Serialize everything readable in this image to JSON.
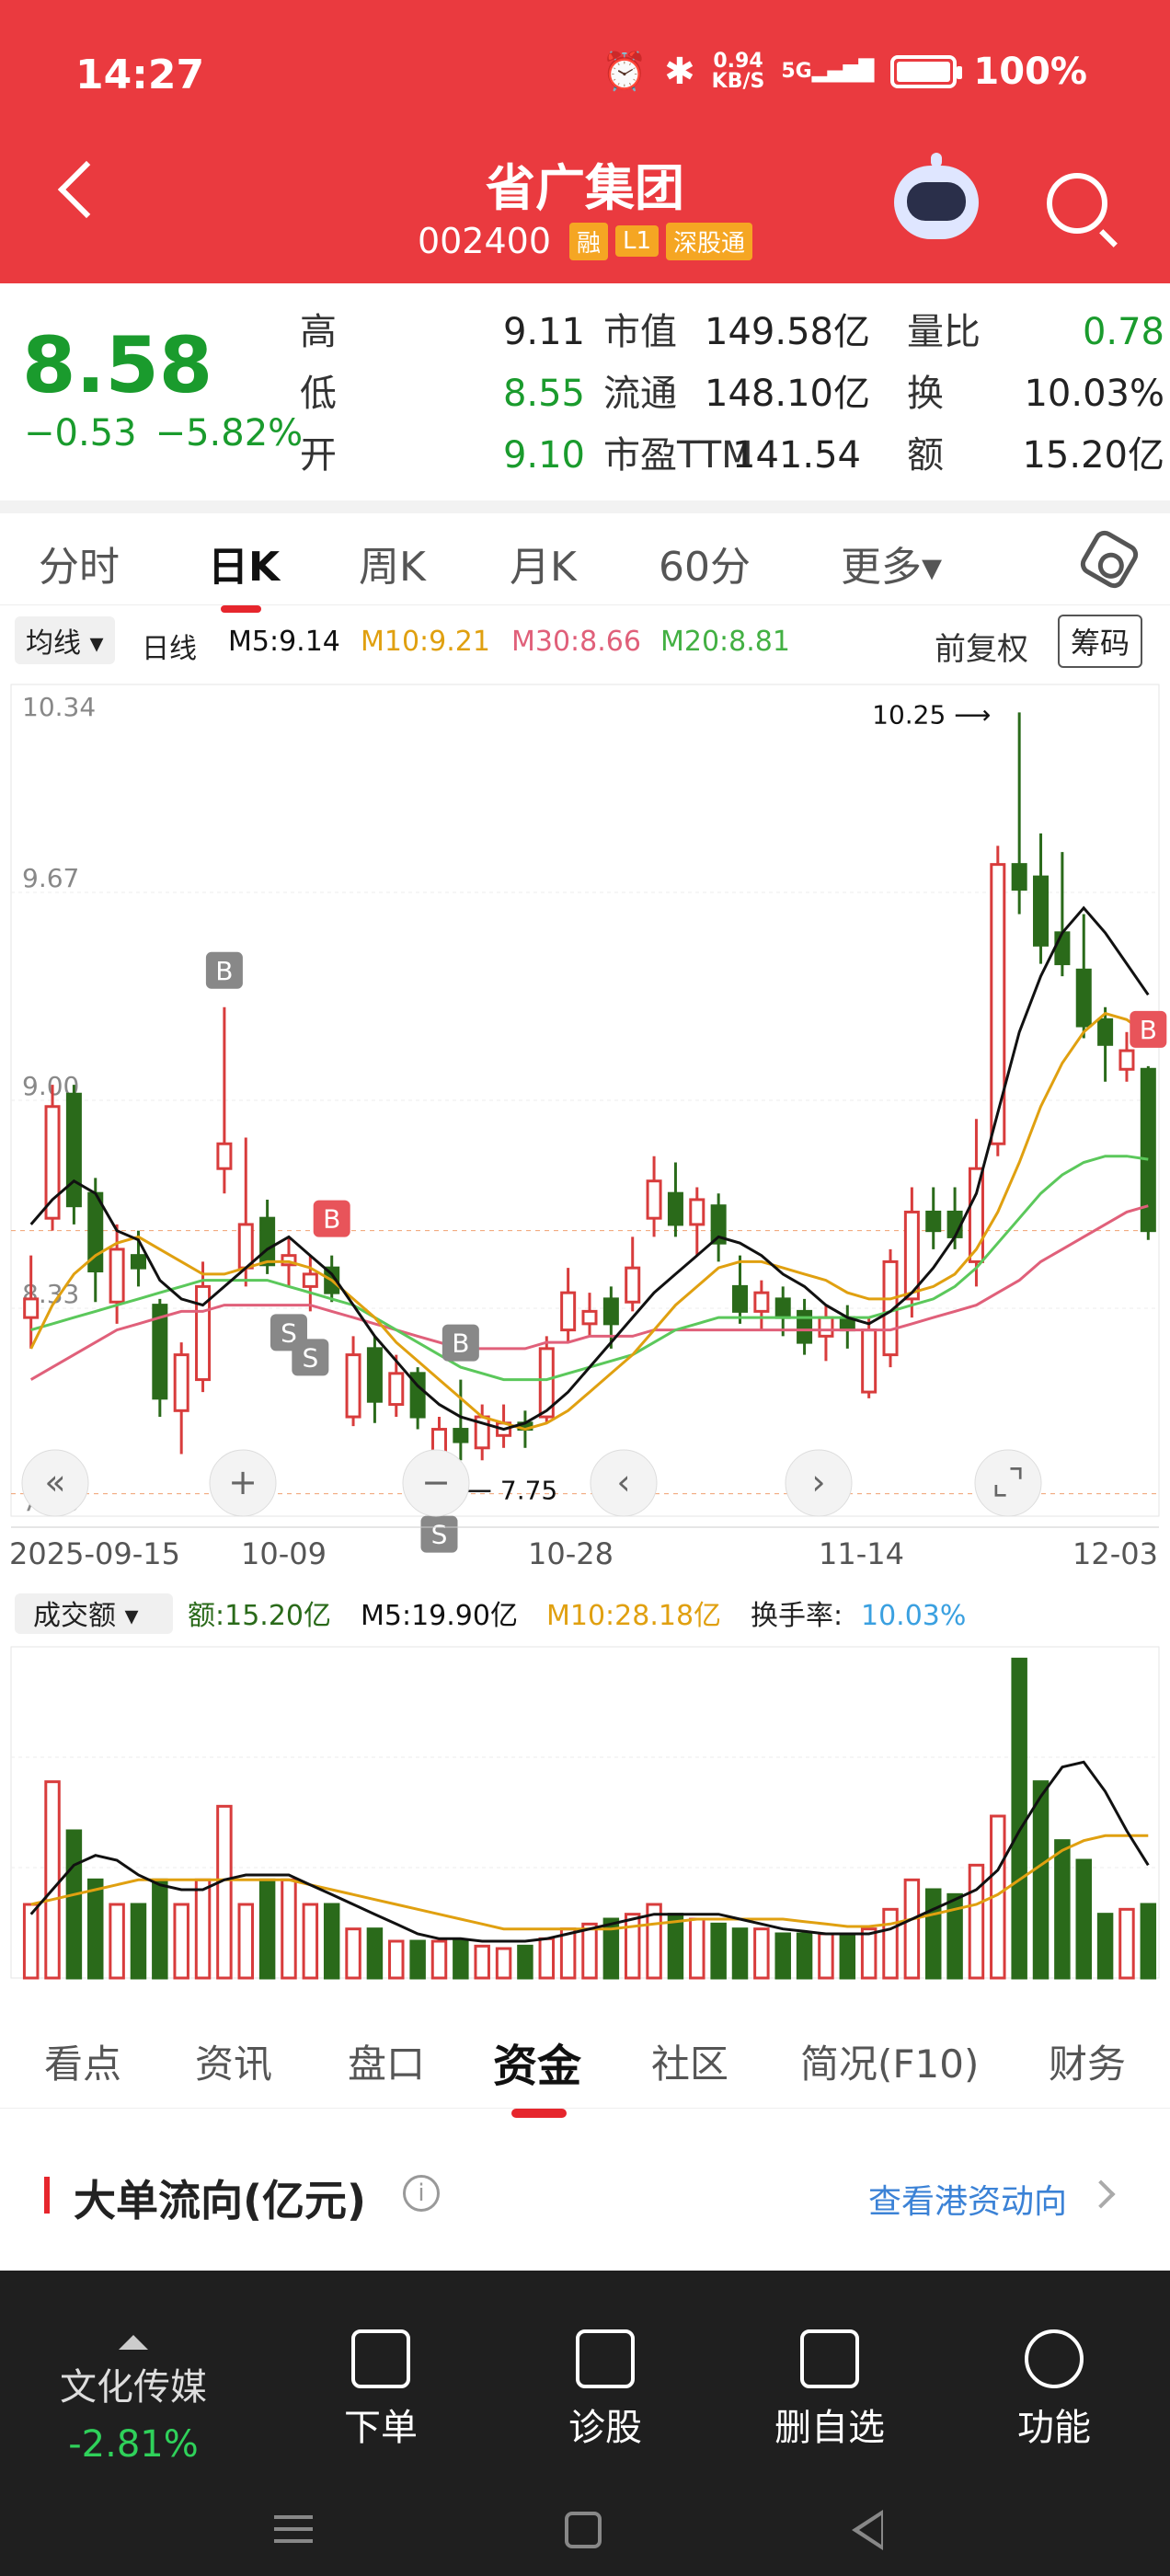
{
  "status": {
    "time": "14:27",
    "netspeed_value": "0.94",
    "netspeed_unit": "KB/S",
    "signal": "5G",
    "battery": "100%"
  },
  "header": {
    "title": "省广集团",
    "code": "002400",
    "tags": [
      "融",
      "L1",
      "深股通"
    ]
  },
  "quote": {
    "price": "8.58",
    "change": "−0.53",
    "change_pct": "−5.82%",
    "rows": [
      {
        "l1": "高",
        "v1": "9.11",
        "l2": "市值",
        "v2": "149.58亿",
        "l3": "量比",
        "v3": "0.78"
      },
      {
        "l1": "低",
        "v1": "8.55",
        "l2": "流通",
        "v2": "148.10亿",
        "l3": "换",
        "v3": "10.03%"
      },
      {
        "l1": "开",
        "v1": "9.10",
        "l2": "市盈TTM",
        "v2": "141.54",
        "l3": "额",
        "v3": "15.20亿"
      }
    ]
  },
  "period_tabs": [
    "分时",
    "日K",
    "周K",
    "月K",
    "60分",
    "更多▾"
  ],
  "ma_legend": {
    "selector": "均线 ▾",
    "period": "日线",
    "m5": "M5:9.14",
    "m10": "M10:9.21",
    "m30": "M30:8.66",
    "m20": "M20:8.81",
    "fq": "前复权",
    "chip": "筹码"
  },
  "chart_data": {
    "type": "candlestick",
    "y_ticks": [
      "10.34",
      "9.67",
      "9.00",
      "8.33",
      "7.66"
    ],
    "x_ticks": [
      "2025-09-15",
      "10-09",
      "10-28",
      "11-14",
      "12-03"
    ],
    "high_label": "10.25",
    "low_label": "7.75",
    "ylim": [
      7.66,
      10.34
    ],
    "candles": [
      {
        "o": 8.3,
        "c": 8.36,
        "h": 8.5,
        "l": 8.2
      },
      {
        "o": 8.62,
        "c": 8.98,
        "h": 9.05,
        "l": 8.58
      },
      {
        "o": 9.02,
        "c": 8.66,
        "h": 9.05,
        "l": 8.6
      },
      {
        "o": 8.7,
        "c": 8.45,
        "h": 8.75,
        "l": 8.35
      },
      {
        "o": 8.35,
        "c": 8.52,
        "h": 8.6,
        "l": 8.28
      },
      {
        "o": 8.5,
        "c": 8.46,
        "h": 8.58,
        "l": 8.4
      },
      {
        "o": 8.34,
        "c": 8.04,
        "h": 8.36,
        "l": 7.98
      },
      {
        "o": 8.0,
        "c": 8.18,
        "h": 8.22,
        "l": 7.86
      },
      {
        "o": 8.1,
        "c": 8.4,
        "h": 8.48,
        "l": 8.06
      },
      {
        "o": 8.78,
        "c": 8.86,
        "h": 9.3,
        "l": 8.7
      },
      {
        "o": 8.46,
        "c": 8.6,
        "h": 8.88,
        "l": 8.4
      },
      {
        "o": 8.62,
        "c": 8.47,
        "h": 8.68,
        "l": 8.44
      },
      {
        "o": 8.47,
        "c": 8.5,
        "h": 8.56,
        "l": 8.4
      },
      {
        "o": 8.4,
        "c": 8.44,
        "h": 8.5,
        "l": 8.32
      },
      {
        "o": 8.46,
        "c": 8.38,
        "h": 8.5,
        "l": 8.35
      },
      {
        "o": 7.98,
        "c": 8.18,
        "h": 8.24,
        "l": 7.95
      },
      {
        "o": 8.2,
        "c": 8.03,
        "h": 8.24,
        "l": 7.96
      },
      {
        "o": 8.02,
        "c": 8.12,
        "h": 8.18,
        "l": 7.98
      },
      {
        "o": 8.12,
        "c": 7.98,
        "h": 8.14,
        "l": 7.94
      },
      {
        "o": 7.86,
        "c": 7.94,
        "h": 7.98,
        "l": 7.75
      },
      {
        "o": 7.94,
        "c": 7.9,
        "h": 8.1,
        "l": 7.84
      },
      {
        "o": 7.88,
        "c": 7.98,
        "h": 8.02,
        "l": 7.84
      },
      {
        "o": 7.92,
        "c": 7.96,
        "h": 8.02,
        "l": 7.88
      },
      {
        "o": 7.96,
        "c": 7.94,
        "h": 8.0,
        "l": 7.88
      },
      {
        "o": 7.98,
        "c": 8.2,
        "h": 8.24,
        "l": 7.96
      },
      {
        "o": 8.26,
        "c": 8.38,
        "h": 8.46,
        "l": 8.22
      },
      {
        "o": 8.28,
        "c": 8.32,
        "h": 8.38,
        "l": 8.24
      },
      {
        "o": 8.36,
        "c": 8.28,
        "h": 8.4,
        "l": 8.2
      },
      {
        "o": 8.35,
        "c": 8.46,
        "h": 8.56,
        "l": 8.32
      },
      {
        "o": 8.62,
        "c": 8.74,
        "h": 8.82,
        "l": 8.56
      },
      {
        "o": 8.7,
        "c": 8.6,
        "h": 8.8,
        "l": 8.56
      },
      {
        "o": 8.6,
        "c": 8.68,
        "h": 8.72,
        "l": 8.5
      },
      {
        "o": 8.66,
        "c": 8.54,
        "h": 8.7,
        "l": 8.48
      },
      {
        "o": 8.4,
        "c": 8.32,
        "h": 8.5,
        "l": 8.28
      },
      {
        "o": 8.32,
        "c": 8.38,
        "h": 8.42,
        "l": 8.26
      },
      {
        "o": 8.36,
        "c": 8.3,
        "h": 8.4,
        "l": 8.24
      },
      {
        "o": 8.32,
        "c": 8.22,
        "h": 8.36,
        "l": 8.18
      },
      {
        "o": 8.24,
        "c": 8.3,
        "h": 8.34,
        "l": 8.16
      },
      {
        "o": 8.3,
        "c": 8.26,
        "h": 8.34,
        "l": 8.2
      },
      {
        "o": 8.06,
        "c": 8.26,
        "h": 8.3,
        "l": 8.04
      },
      {
        "o": 8.18,
        "c": 8.48,
        "h": 8.52,
        "l": 8.14
      },
      {
        "o": 8.36,
        "c": 8.64,
        "h": 8.72,
        "l": 8.3
      },
      {
        "o": 8.64,
        "c": 8.58,
        "h": 8.72,
        "l": 8.52
      },
      {
        "o": 8.64,
        "c": 8.56,
        "h": 8.72,
        "l": 8.52
      },
      {
        "o": 8.48,
        "c": 8.78,
        "h": 8.94,
        "l": 8.4
      },
      {
        "o": 8.86,
        "c": 9.76,
        "h": 9.82,
        "l": 8.82
      },
      {
        "o": 9.76,
        "c": 9.68,
        "h": 10.25,
        "l": 9.6
      },
      {
        "o": 9.72,
        "c": 9.5,
        "h": 9.86,
        "l": 9.44
      },
      {
        "o": 9.54,
        "c": 9.44,
        "h": 9.8,
        "l": 9.4
      },
      {
        "o": 9.42,
        "c": 9.24,
        "h": 9.6,
        "l": 9.2
      },
      {
        "o": 9.26,
        "c": 9.18,
        "h": 9.3,
        "l": 9.06
      },
      {
        "o": 9.1,
        "c": 9.16,
        "h": 9.22,
        "l": 9.06
      },
      {
        "o": 9.1,
        "c": 8.58,
        "h": 9.11,
        "l": 8.55
      }
    ],
    "ma": {
      "M5": [
        8.6,
        8.68,
        8.74,
        8.7,
        8.58,
        8.55,
        8.42,
        8.36,
        8.34,
        8.4,
        8.46,
        8.52,
        8.56,
        8.5,
        8.44,
        8.34,
        8.24,
        8.16,
        8.08,
        8.02,
        7.98,
        7.96,
        7.94,
        7.96,
        8.0,
        8.06,
        8.14,
        8.22,
        8.3,
        8.38,
        8.44,
        8.5,
        8.56,
        8.54,
        8.5,
        8.44,
        8.4,
        8.34,
        8.3,
        8.28,
        8.32,
        8.38,
        8.46,
        8.56,
        8.7,
        8.96,
        9.22,
        9.4,
        9.54,
        9.62,
        9.54,
        9.44,
        9.34
      ],
      "M10": [
        8.2,
        8.34,
        8.44,
        8.5,
        8.54,
        8.56,
        8.52,
        8.48,
        8.44,
        8.44,
        8.46,
        8.48,
        8.48,
        8.46,
        8.42,
        8.36,
        8.3,
        8.22,
        8.16,
        8.1,
        8.04,
        7.98,
        7.96,
        7.94,
        7.96,
        8.0,
        8.06,
        8.12,
        8.18,
        8.26,
        8.34,
        8.4,
        8.46,
        8.48,
        8.48,
        8.46,
        8.44,
        8.42,
        8.38,
        8.36,
        8.36,
        8.38,
        8.4,
        8.44,
        8.52,
        8.64,
        8.8,
        8.98,
        9.12,
        9.22,
        9.28,
        9.26,
        9.21
      ],
      "M20": [
        8.26,
        8.28,
        8.3,
        8.32,
        8.34,
        8.36,
        8.38,
        8.4,
        8.42,
        8.42,
        8.42,
        8.42,
        8.4,
        8.38,
        8.36,
        8.34,
        8.3,
        8.26,
        8.22,
        8.18,
        8.14,
        8.12,
        8.1,
        8.1,
        8.1,
        8.12,
        8.14,
        8.16,
        8.18,
        8.22,
        8.26,
        8.28,
        8.3,
        8.3,
        8.3,
        8.3,
        8.3,
        8.3,
        8.3,
        8.3,
        8.32,
        8.34,
        8.36,
        8.4,
        8.46,
        8.54,
        8.62,
        8.7,
        8.76,
        8.8,
        8.82,
        8.82,
        8.81
      ],
      "M30": [
        8.1,
        8.14,
        8.18,
        8.22,
        8.26,
        8.28,
        8.3,
        8.32,
        8.32,
        8.34,
        8.34,
        8.34,
        8.34,
        8.34,
        8.32,
        8.3,
        8.28,
        8.26,
        8.24,
        8.22,
        8.2,
        8.2,
        8.2,
        8.2,
        8.22,
        8.22,
        8.24,
        8.24,
        8.24,
        8.26,
        8.26,
        8.26,
        8.26,
        8.26,
        8.26,
        8.26,
        8.26,
        8.26,
        8.26,
        8.26,
        8.26,
        8.28,
        8.3,
        8.32,
        8.34,
        8.38,
        8.42,
        8.48,
        8.52,
        8.56,
        8.6,
        8.64,
        8.66
      ]
    },
    "signals": [
      {
        "i": 9,
        "label": "B"
      },
      {
        "i": 12,
        "label": "S"
      },
      {
        "i": 13,
        "label": "S"
      },
      {
        "i": 14,
        "label": "B"
      },
      {
        "i": 19,
        "label": "S"
      },
      {
        "i": 20,
        "label": "B"
      },
      {
        "i": 52,
        "label": "B"
      }
    ],
    "volume_legend": {
      "selector": "成交额 ▾",
      "amount": "额:15.20亿",
      "m5": "M5:19.90亿",
      "m10": "M10:28.18亿",
      "turnover_label": "换手率:",
      "turnover": "10.03%"
    },
    "volume": [
      3,
      8,
      6,
      4,
      3,
      3,
      4,
      3,
      4,
      7,
      3,
      4,
      4,
      3,
      3,
      2,
      2,
      1.5,
      1.5,
      1.5,
      1.5,
      1.3,
      1.2,
      1.3,
      1.6,
      2,
      2.2,
      2.4,
      2.6,
      3,
      2.6,
      2.4,
      2.2,
      2,
      2,
      1.8,
      1.8,
      1.8,
      1.8,
      2,
      2.8,
      4,
      3.6,
      3.4,
      4.6,
      6.6,
      13,
      8,
      5.6,
      4.8,
      2.6,
      2.8,
      3
    ],
    "vol_m5": [
      2.6,
      3.6,
      4.6,
      5,
      4.8,
      4.2,
      3.8,
      3.6,
      3.6,
      4,
      4.2,
      4.2,
      4.2,
      3.8,
      3.4,
      3,
      2.6,
      2.2,
      1.8,
      1.6,
      1.6,
      1.5,
      1.5,
      1.5,
      1.6,
      1.8,
      2,
      2.2,
      2.4,
      2.6,
      2.6,
      2.6,
      2.6,
      2.4,
      2.2,
      2,
      1.9,
      1.8,
      1.8,
      1.8,
      2,
      2.4,
      2.8,
      3.2,
      3.6,
      4.4,
      6,
      7.4,
      8.6,
      8.8,
      7.6,
      6,
      4.6
    ],
    "vol_m10": [
      3,
      3.2,
      3.4,
      3.6,
      3.8,
      4,
      4,
      4,
      4,
      4,
      4,
      4,
      4,
      3.8,
      3.6,
      3.4,
      3.2,
      3,
      2.8,
      2.6,
      2.4,
      2.2,
      2,
      2,
      2,
      2,
      2,
      2,
      2.1,
      2.2,
      2.3,
      2.4,
      2.4,
      2.4,
      2.4,
      2.4,
      2.3,
      2.2,
      2.1,
      2.1,
      2.2,
      2.4,
      2.6,
      2.8,
      3,
      3.4,
      4,
      4.6,
      5.2,
      5.6,
      5.8,
      5.8,
      5.8
    ]
  },
  "bottom_tabs": [
    "看点",
    "资讯",
    "盘口",
    "资金",
    "社区",
    "简况(F10)",
    "财务"
  ],
  "big_order": {
    "title": "大单流向(亿元)",
    "link": "查看港资动向"
  },
  "dock": {
    "sector_name": "文化传媒",
    "sector_pct": "-2.81%",
    "items": [
      "下单",
      "诊股",
      "删自选",
      "功能"
    ]
  },
  "colors": {
    "header": "#ea3a3f",
    "up": "#d83c3c",
    "down": "#2a6a1a",
    "m5": "#111111",
    "m10": "#e0a010",
    "m20": "#5bc85b",
    "m30": "#e0607a"
  }
}
